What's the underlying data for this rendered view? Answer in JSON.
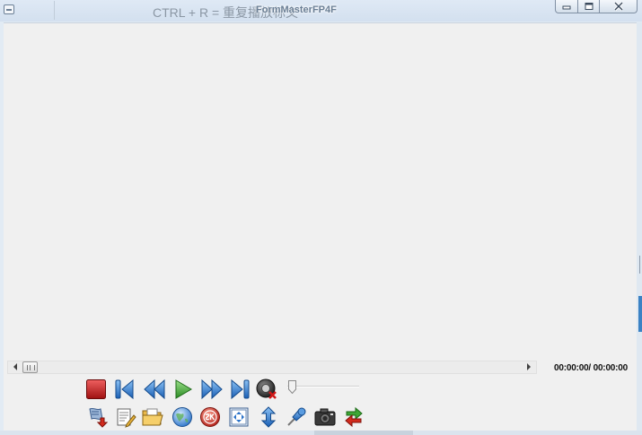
{
  "window": {
    "title": "FormMasterFP4F",
    "hint": "CTRL + R = 重复播放标文"
  },
  "titlebar_buttons": {
    "minimize_icon": "minimize-icon",
    "maximize_icon": "maximize-icon",
    "close_icon": "close-icon"
  },
  "player": {
    "time_display": "00:00:00/ 00:00:00",
    "volume": 0.0
  },
  "controls_row1": [
    {
      "name": "stop-button",
      "icon": "stop-icon"
    },
    {
      "name": "previous-button",
      "icon": "skip-back-icon"
    },
    {
      "name": "rewind-button",
      "icon": "rewind-icon"
    },
    {
      "name": "play-button",
      "icon": "play-icon"
    },
    {
      "name": "fast-forward-button",
      "icon": "fast-forward-icon"
    },
    {
      "name": "next-button",
      "icon": "skip-forward-icon"
    },
    {
      "name": "mute-button",
      "icon": "speaker-mute-icon"
    }
  ],
  "controls_row2": [
    {
      "name": "import-button",
      "icon": "import-icon"
    },
    {
      "name": "edit-button",
      "icon": "edit-icon"
    },
    {
      "name": "open-folder-button",
      "icon": "folder-icon"
    },
    {
      "name": "web-button",
      "icon": "globe-icon"
    },
    {
      "name": "sk-button",
      "icon": "sk-icon"
    },
    {
      "name": "fit-window-button",
      "icon": "fit-icon"
    },
    {
      "name": "resize-vertical-button",
      "icon": "vertical-arrows-icon"
    },
    {
      "name": "pin-button",
      "icon": "pin-icon"
    },
    {
      "name": "snapshot-button",
      "icon": "camera-icon"
    },
    {
      "name": "refresh-button",
      "icon": "refresh-icon"
    }
  ],
  "colors": {
    "stop": "#c0201e",
    "nav_blue": "#2b73c9",
    "play_green": "#3ea636",
    "titlebar": "#d9e4f1",
    "client": "#f0f0f0"
  }
}
